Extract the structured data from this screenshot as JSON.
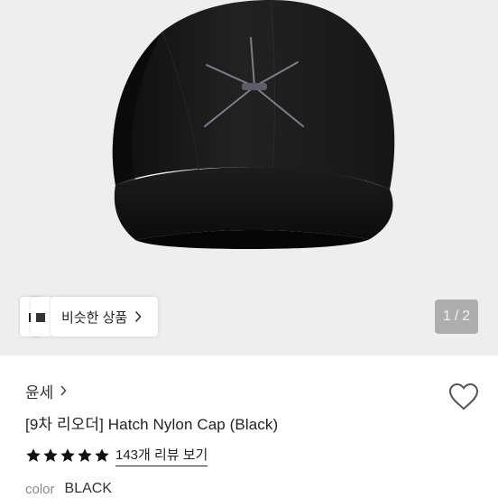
{
  "gallery": {
    "similar_label": "비슷한 상품",
    "counter_current": "1",
    "counter_sep": "/",
    "counter_total": "2",
    "product_image_icon": "black-cap-photo"
  },
  "product": {
    "seller": "윤세",
    "title": "[9차 리오더] Hatch Nylon Cap (Black)",
    "rating_stars": 5,
    "rating_max": 5,
    "review_link": "143개 리뷰 보기",
    "color_label": "color",
    "color_value": "BLACK"
  },
  "colors": {
    "page_bg": "#ffffff",
    "hero_bg": "#eeeeee",
    "cap": "#151515",
    "star": "#111111",
    "muted": "#8a8a8a"
  }
}
